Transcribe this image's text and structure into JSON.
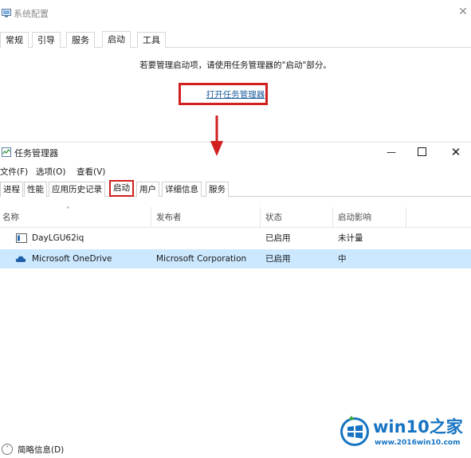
{
  "msconfig": {
    "title": "系统配置",
    "tabs": [
      {
        "label": "常规",
        "active": false
      },
      {
        "label": "引导",
        "active": false
      },
      {
        "label": "服务",
        "active": false
      },
      {
        "label": "启动",
        "active": true
      },
      {
        "label": "工具",
        "active": false
      }
    ],
    "startup_message": "若要管理启动项，请使用任务管理器的\"启动\"部分。",
    "open_task_manager_link": "打开任务管理器"
  },
  "task_manager": {
    "title": "任务管理器",
    "menu": [
      "文件(F)",
      "选项(O)",
      "查看(V)"
    ],
    "tabs": [
      {
        "label": "进程",
        "active": false
      },
      {
        "label": "性能",
        "active": false
      },
      {
        "label": "应用历史记录",
        "active": false
      },
      {
        "label": "启动",
        "active": true
      },
      {
        "label": "用户",
        "active": false
      },
      {
        "label": "详细信息",
        "active": false
      },
      {
        "label": "服务",
        "active": false
      }
    ],
    "columns": [
      "名称",
      "发布者",
      "状态",
      "启动影响"
    ],
    "rows": [
      {
        "name": "DayLGU62iq",
        "publisher": "",
        "status": "已启用",
        "impact": "未计量",
        "icon": "app-window-icon",
        "selected": false
      },
      {
        "name": "Microsoft OneDrive",
        "publisher": "Microsoft Corporation",
        "status": "已启用",
        "impact": "中",
        "icon": "onedrive-cloud-icon",
        "selected": true
      }
    ],
    "footer_label": "简略信息(D)"
  },
  "watermark": {
    "brand": "win10之家",
    "url": "www.2016win10.com"
  },
  "colors": {
    "highlight_red": "#d21f1f",
    "link_blue": "#1f5e9e",
    "selected_row": "#cce8ff",
    "watermark_blue": "#1674c2"
  }
}
